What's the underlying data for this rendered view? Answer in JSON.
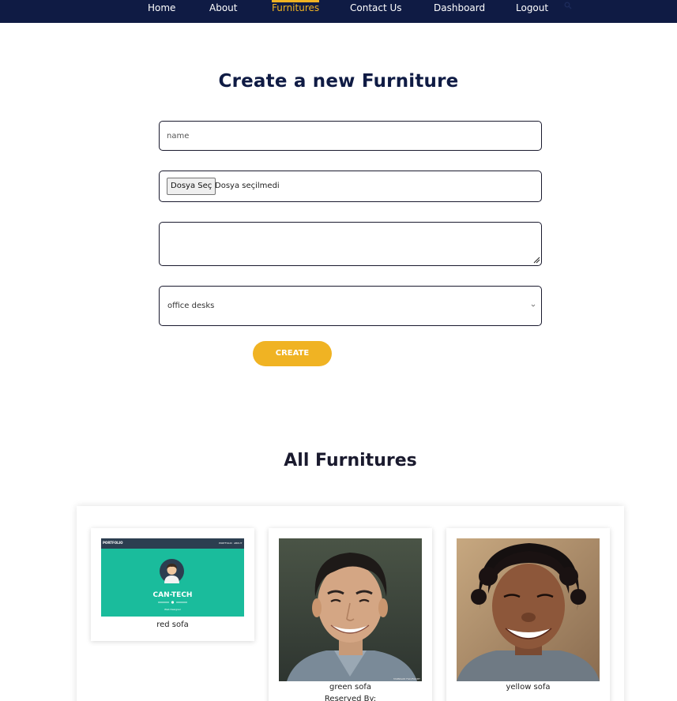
{
  "nav": {
    "items": [
      {
        "label": "Home"
      },
      {
        "label": "About"
      },
      {
        "label": "Furnitures"
      },
      {
        "label": "Contact Us"
      },
      {
        "label": "Dashboard"
      },
      {
        "label": "Logout"
      }
    ],
    "active_item": "Furnitures",
    "icon": "search-icon"
  },
  "form": {
    "title": "Create a new Furniture",
    "name_placeholder": "name",
    "file_button_label": "Dosya Seç",
    "file_status": "Dosya seçilmedi",
    "description_value": "",
    "category_selected": "office desks",
    "submit_label": "CREATE"
  },
  "list": {
    "title": "All Furnitures",
    "cards": [
      {
        "name": "red sofa",
        "thumbnail": {
          "brand": "PORTFOLIO",
          "links": [
            "PORTFOLIO",
            "ABOUT"
          ],
          "heading": "CAN-TECH",
          "subtitle": "Web Designer"
        }
      },
      {
        "name": "green sofa",
        "reserved_label": "Reserved By:",
        "watermark": "TANNSAID FGD/FAK/BT"
      },
      {
        "name": "yellow sofa"
      }
    ]
  },
  "colors": {
    "navbar_bg": "#0f1b44",
    "accent": "#f0b323",
    "thumbnail_green": "#1abc9c",
    "thumbnail_bar": "#2c3e50"
  }
}
